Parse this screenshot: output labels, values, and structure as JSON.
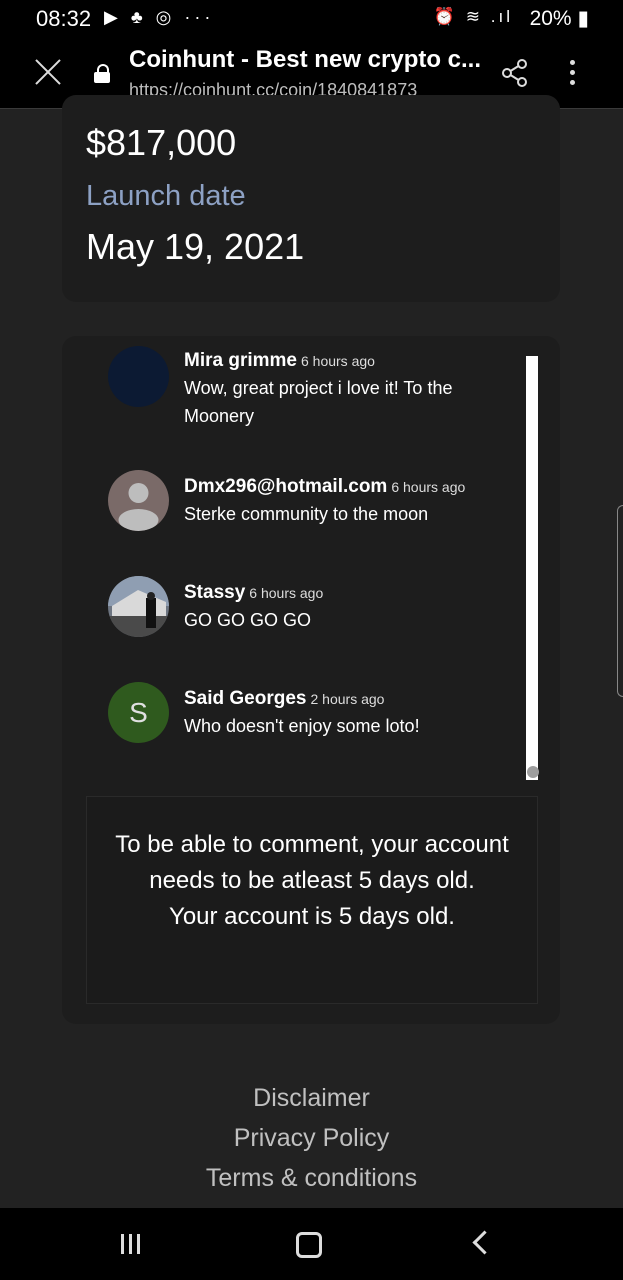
{
  "status_bar": {
    "time": "08:32",
    "left_icons": "▶ ♣ ◎ ···",
    "right_icons": "⏰ ≋ .ıl",
    "battery": "20%"
  },
  "browser": {
    "title": "Coinhunt - Best new crypto c...",
    "url": "https://coinhunt.cc/coin/1840841873"
  },
  "coin": {
    "value": "$817,000",
    "launch_label": "Launch date",
    "launch_date": "May 19, 2021"
  },
  "comments": [
    {
      "name": "Mira grimme",
      "time": "6 hours ago",
      "text": "Wow, great project i love it! To the Moonery"
    },
    {
      "name": "Dmx296@hotmail.com",
      "time": "6 hours ago",
      "text": "Sterke community to the moon"
    },
    {
      "name": "Stassy",
      "time": "6 hours ago",
      "text": "GO GO GO GO"
    },
    {
      "name": "Said Georges",
      "time": "2 hours ago",
      "text": "Who doesn't enjoy some loto!",
      "initial": "S"
    }
  ],
  "notice": {
    "line1": "To be able to comment, your account needs to be atleast 5 days old.",
    "line2": "Your account is 5 days old."
  },
  "footer": {
    "disclaimer": "Disclaimer",
    "privacy": "Privacy Policy",
    "terms": "Terms & conditions"
  }
}
